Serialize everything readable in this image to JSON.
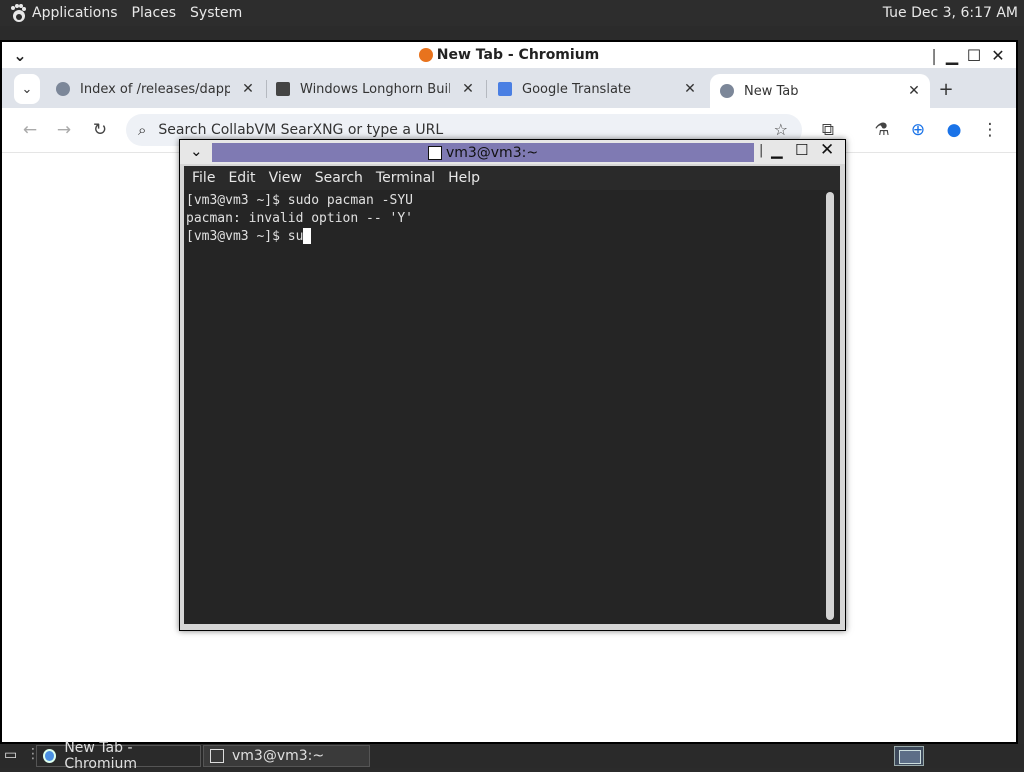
{
  "top_panel": {
    "applications": "Applications",
    "places": "Places",
    "system": "System",
    "clock": "Tue Dec  3,  6:17 AM"
  },
  "chromium": {
    "title": "New Tab - Chromium",
    "tabs": [
      {
        "label": "Index of /releases/dapper",
        "favicon": "globe-icon"
      },
      {
        "label": "Windows Longhorn Build",
        "favicon": "columns-icon"
      },
      {
        "label": "Google Translate",
        "favicon": "translate-icon"
      },
      {
        "label": "New Tab",
        "favicon": "chrome-icon"
      }
    ],
    "omnibox_placeholder": "Search CollabVM SearXNG or type a URL"
  },
  "terminal": {
    "title": "vm3@vm3:~",
    "menu": [
      "File",
      "Edit",
      "View",
      "Search",
      "Terminal",
      "Help"
    ],
    "lines": [
      "[vm3@vm3 ~]$ sudo pacman -SYU",
      "pacman: invalid option -- 'Y'",
      "[vm3@vm3 ~]$ su"
    ]
  },
  "taskbar": {
    "tasks": [
      {
        "label": "New Tab - Chromium"
      },
      {
        "label": "vm3@vm3:~"
      }
    ]
  },
  "colors": {
    "terminal_bg": "#252525",
    "terminal_title_accent": "#7f7ab3",
    "panel_bg": "#2d2d2d"
  }
}
